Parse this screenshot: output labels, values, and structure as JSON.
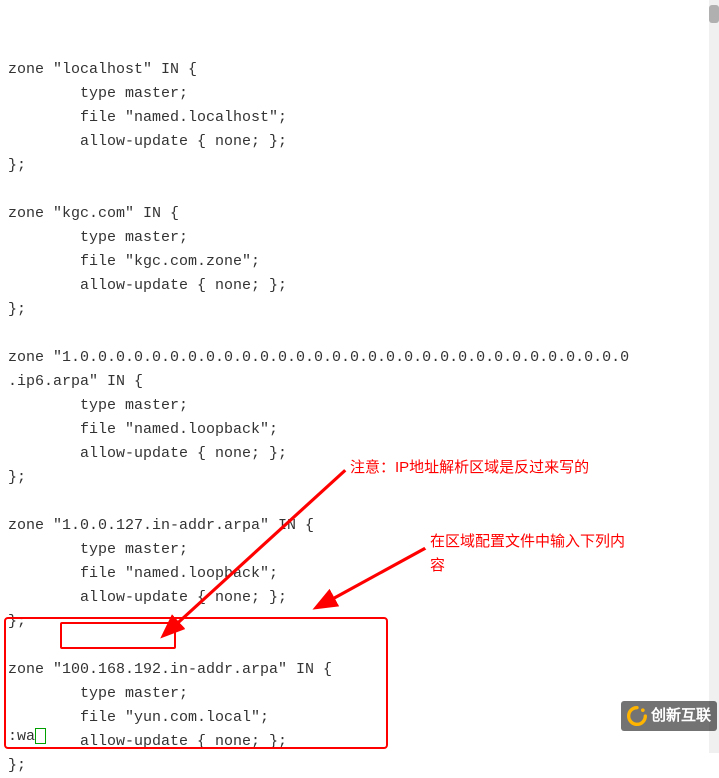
{
  "lines": [
    "",
    "zone \"localhost\" IN {",
    "        type master;",
    "        file \"named.localhost\";",
    "        allow-update { none; };",
    "};",
    "",
    "zone \"kgc.com\" IN {",
    "        type master;",
    "        file \"kgc.com.zone\";",
    "        allow-update { none; };",
    "};",
    "",
    "zone \"1.0.0.0.0.0.0.0.0.0.0.0.0.0.0.0.0.0.0.0.0.0.0.0.0.0.0.0.0.0.0.0",
    ".ip6.arpa\" IN {",
    "        type master;",
    "        file \"named.loopback\";",
    "        allow-update { none; };",
    "};",
    "",
    "zone \"1.0.0.127.in-addr.arpa\" IN {",
    "        type master;",
    "        file \"named.loopback\";",
    "        allow-update { none; };",
    "};",
    "",
    "zone \"100.168.192.in-addr.arpa\" IN {",
    "        type master;",
    "        file \"yun.com.local\";",
    "        allow-update { none; };",
    "};"
  ],
  "annotations": {
    "note1": "注意：IP地址解析区域是反过来写的",
    "note2_line1": "在区域配置文件中输入下列内",
    "note2_line2": "容"
  },
  "bottom_cmd": ":wa",
  "logo_text": "创新互联"
}
